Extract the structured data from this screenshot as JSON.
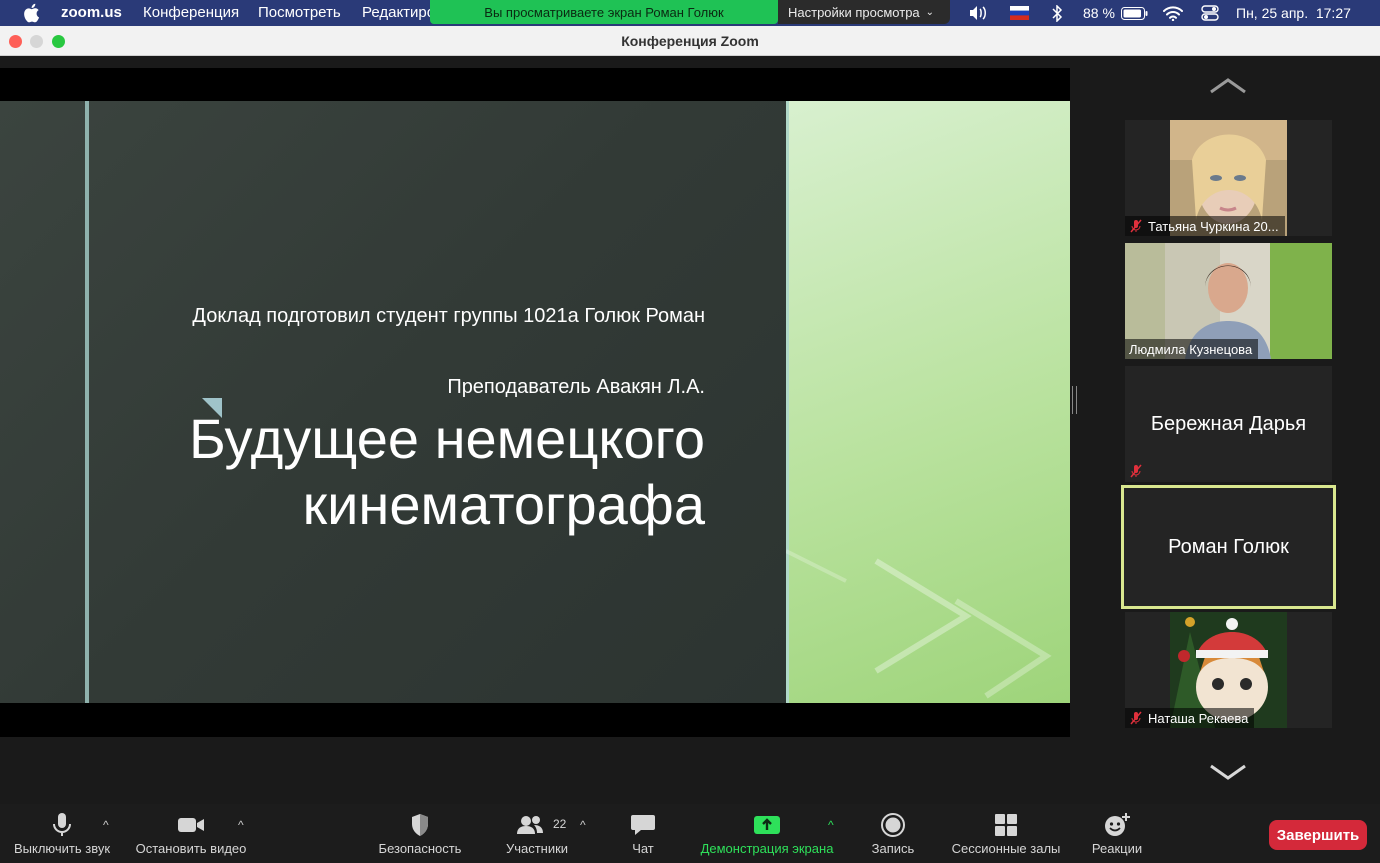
{
  "menubar": {
    "app_name": "zoom.us",
    "items": [
      "Конференция",
      "Посмотреть",
      "Редактиро"
    ],
    "share_banner": "Вы просматриваете экран Роман Голюк",
    "view_options": "Настройки просмотра",
    "battery": "88 %",
    "datetime": "Пн, 25 апр.  17:27"
  },
  "window": {
    "title": "Конференция Zoom"
  },
  "slide": {
    "author": "Доклад подготовил студент группы 1021а Голюк Роман",
    "teacher": "Преподаватель Авакян Л.А.",
    "title": "Будущее немецкого кинематографа"
  },
  "gallery": {
    "tiles": [
      {
        "name": "Татьяна Чуркина 20...",
        "muted": true
      },
      {
        "name": "Людмила Кузнецова",
        "muted": false
      },
      {
        "name": "Бережная Дарья",
        "muted": true
      },
      {
        "name": "Роман Голюк",
        "muted": false
      },
      {
        "name": "Наташа Рекаева",
        "muted": true
      }
    ]
  },
  "toolbar": {
    "mute": "Выключить звук",
    "video": "Остановить видео",
    "security": "Безопасность",
    "participants": "Участники",
    "participants_count": "22",
    "chat": "Чат",
    "share": "Демонстрация экрана",
    "record": "Запись",
    "breakout": "Сессионные залы",
    "reactions": "Реакции",
    "end": "Завершить"
  },
  "colors": {
    "share_green": "#1fc255",
    "end_red": "#d4293a",
    "active_border": "#d9e78f",
    "menubar": "#2a3a78"
  }
}
